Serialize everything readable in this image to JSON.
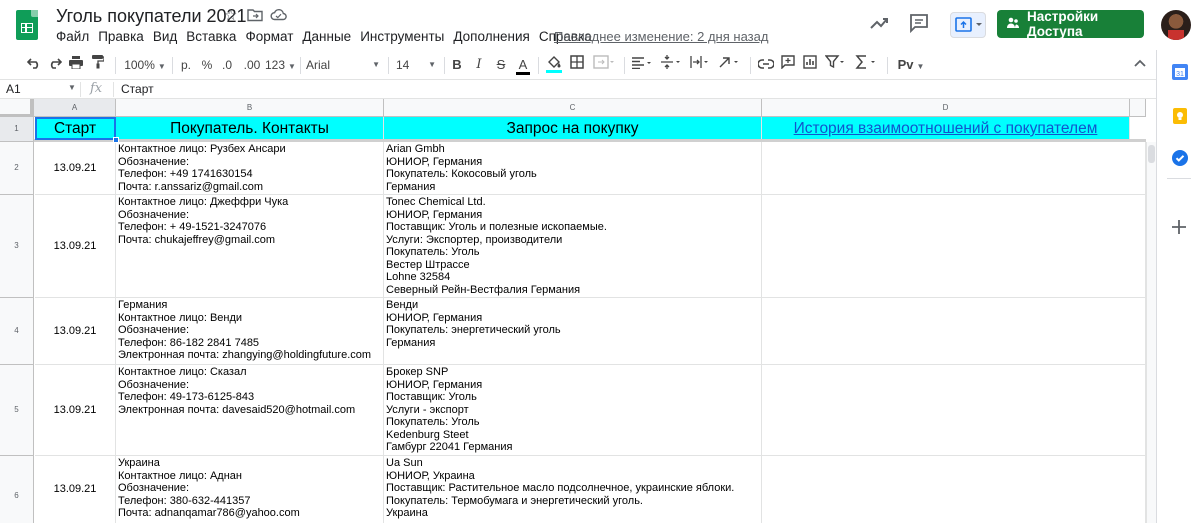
{
  "doc": {
    "title": "Уголь покупатели 2021",
    "last_edit": "Последнее изменение: 2 дня назад",
    "share_label": "Настройки Доступа"
  },
  "menu": [
    "Файл",
    "Правка",
    "Вид",
    "Вставка",
    "Формат",
    "Данные",
    "Инструменты",
    "Дополнения",
    "Справка"
  ],
  "toolbar": {
    "zoom": "100%",
    "currency": "р.",
    "percent": "%",
    "dec_less": ".0",
    "dec_more": ".00",
    "format_more": "123",
    "font": "Arial",
    "font_size": "14",
    "bold": "B",
    "italic": "I",
    "strike": "S",
    "text_color": "A",
    "script": "Pv"
  },
  "formula_bar": {
    "cell_ref": "A1",
    "fx": "fx",
    "content": "Старт"
  },
  "columns": [
    "A",
    "B",
    "C",
    "D"
  ],
  "row_numbers": [
    "1",
    "2",
    "3",
    "4",
    "5",
    "6"
  ],
  "header_row": {
    "a": "Старт",
    "b": "Покупатель. Контакты",
    "c": "Запрос на покупку",
    "d": "История взаимоотношений с покупателем"
  },
  "rows": [
    {
      "date": "13.09.21",
      "contacts": "Контактное лицо: Рузбех Ансари\nОбозначение:\nТелефон: +49 1741630154\nПочта: r.anssariz@gmail.com",
      "request": "Arian Gmbh\nЮНИОР, Германия\nПокупатель: Кокосовый уголь\nГермания",
      "history": ""
    },
    {
      "date": "13.09.21",
      "contacts": "Контактное лицо: Джеффри Чука\nОбозначение:\nТелефон: + 49-1521-3247076\nПочта: chukajeffrey@gmail.com",
      "request": "Tonec Chemical Ltd.\nЮНИОР, Германия\nПоставщик: Уголь и полезные ископаемые.\nУслуги: Экспортер, производители\nПокупатель: Уголь\nВестер Штрассе\nLohne 32584\nСеверный Рейн-Вестфалия Германия",
      "history": ""
    },
    {
      "date": "13.09.21",
      "contacts": "Германия\nКонтактное лицо: Венди\nОбозначение:\nТелефон: 86-182 2841 7485\nЭлектронная почта: zhangying@holdingfuture.com",
      "request": "Венди\nЮНИОР, Германия\nПокупатель: энергетический уголь\nГермания",
      "history": ""
    },
    {
      "date": "13.09.21",
      "contacts": "Контактное лицо: Сказал\nОбозначение:\nТелефон: 49-173-6125-843\nЭлектронная почта: davesaid520@hotmail.com",
      "request": "Брокер SNP\nЮНИОР, Германия\nПоставщик: Уголь\nУслуги - экспорт\nПокупатель: Уголь\nKedenburg Steet\nГамбург 22041 Германия",
      "history": ""
    },
    {
      "date": "13.09.21",
      "contacts": "Украина\nКонтактное лицо: Аднан\nОбозначение:\nТелефон: 380-632-441357\nПочта: adnanqamar786@yahoo.com",
      "request": "Ua Sun\nЮНИОР, Украина\nПоставщик: Растительное масло подсолнечное, украинские яблоки.\nПокупатель: Термобумага и энергетический уголь.\nУкраина",
      "history": ""
    }
  ],
  "colors": {
    "header_fill": "#00ffff",
    "link": "#1155cc",
    "share_button": "#188038",
    "selection": "#1a73e8"
  }
}
